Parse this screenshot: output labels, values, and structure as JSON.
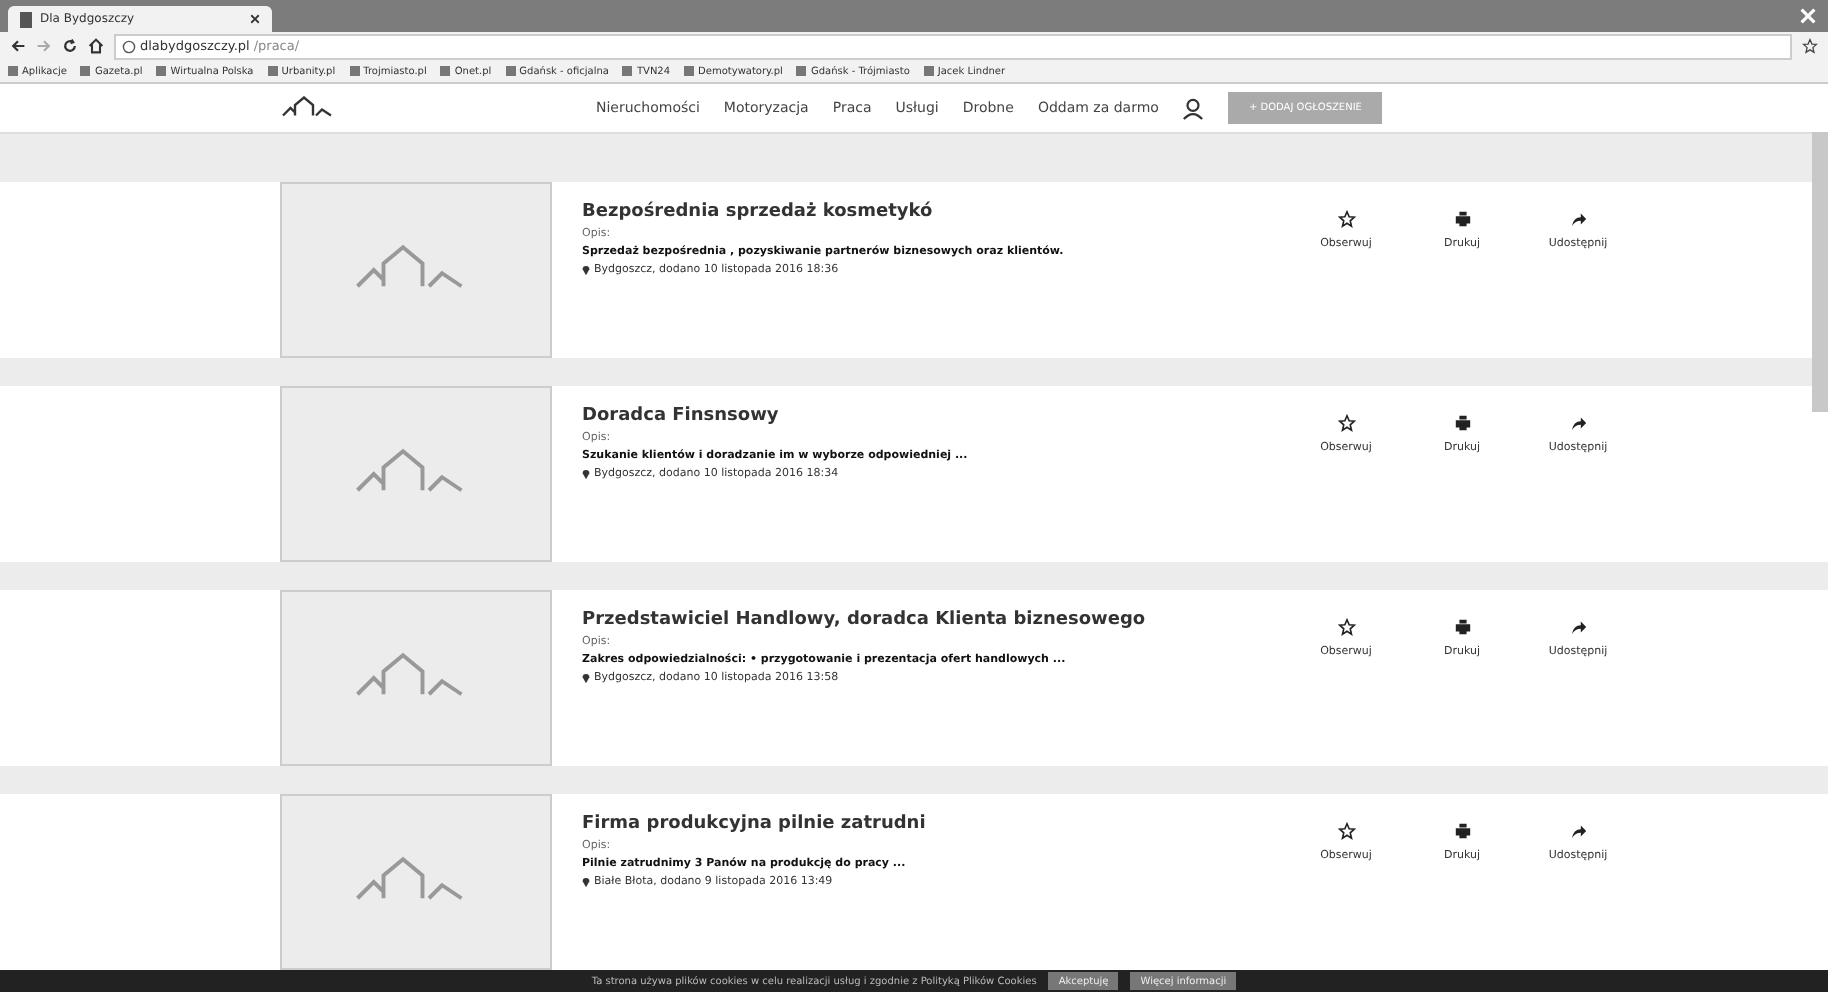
{
  "browser": {
    "tab_title": "Dla Bydgoszczy",
    "url_host": "dlabydgoszczy.pl",
    "url_path": "/praca/",
    "bookmarks": [
      "Aplikacje",
      "Gazeta.pl",
      "Wirtualna Polska",
      "Urbanity.pl",
      "Trojmiasto.pl",
      "Onet.pl",
      "Gdańsk - oficjalna",
      "TVN24",
      "Demotywatory.pl",
      "Gdańsk - Trójmiasto",
      "Jacek Lindner"
    ]
  },
  "nav": {
    "items": [
      "Nieruchomości",
      "Motoryzacja",
      "Praca",
      "Usługi",
      "Drobne",
      "Oddam za darmo"
    ],
    "add_button": "+ DODAJ OGŁOSZENIE"
  },
  "listings": [
    {
      "title": "Bezpośrednia sprzedaż kosmetykó",
      "desc_label": "Opis:",
      "description": "Sprzedaż bezpośrednia , pozyskiwanie partnerów biznesowych oraz klientów.",
      "meta": "Bydgoszcz, dodano 10 listopada 2016 18:36",
      "actions": [
        {
          "kind": "watch",
          "label": "Obserwuj"
        },
        {
          "kind": "print",
          "label": "Drukuj"
        },
        {
          "kind": "share",
          "label": "Udostępnij"
        }
      ]
    },
    {
      "title": "Doradca Finsnsowy",
      "desc_label": "Opis:",
      "description": "Szukanie klientów i doradzanie im w wyborze odpowiedniej ...",
      "meta": "Bydgoszcz, dodano 10 listopada 2016 18:34",
      "actions": [
        {
          "kind": "watch",
          "label": "Obserwuj"
        },
        {
          "kind": "print",
          "label": "Drukuj"
        },
        {
          "kind": "share",
          "label": "Udostępnij"
        }
      ]
    },
    {
      "title": "Przedstawiciel Handlowy, doradca Klienta biznesowego",
      "desc_label": "Opis:",
      "description": "Zakres odpowiedzialności: • przygotowanie i prezentacja ofert handlowych ...",
      "meta": "Bydgoszcz, dodano 10 listopada 2016 13:58",
      "actions": [
        {
          "kind": "watch",
          "label": "Obserwuj"
        },
        {
          "kind": "print",
          "label": "Drukuj"
        },
        {
          "kind": "share",
          "label": "Udostępnij"
        }
      ]
    },
    {
      "title": "Firma produkcyjna pilnie zatrudni",
      "desc_label": "Opis:",
      "description": "Pilnie zatrudnimy 3 Panów na produkcję do pracy ...",
      "meta": "Białe Błota, dodano 9 listopada 2016 13:49",
      "actions": [
        {
          "kind": "watch",
          "label": "Obserwuj"
        },
        {
          "kind": "print",
          "label": "Drukuj"
        },
        {
          "kind": "share",
          "label": "Udostępnij"
        }
      ]
    }
  ],
  "cookie_bar": {
    "text": "Ta strona używa plików cookies w celu realizacji usług i zgodnie z Polityką Plików Cookies",
    "accept": "Akceptuję",
    "more": "Więcej informacji"
  }
}
